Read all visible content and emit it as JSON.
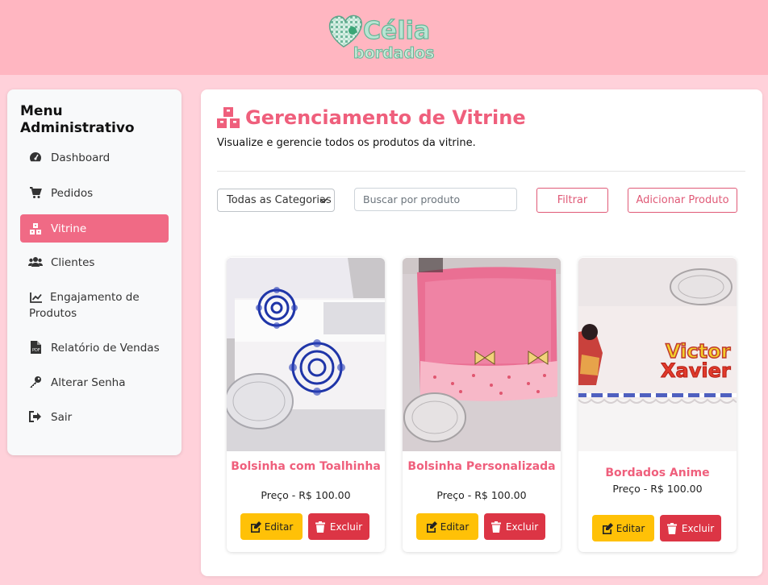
{
  "brand": {
    "logo_line1": "Célia",
    "logo_line2": "bordados"
  },
  "sidebar": {
    "title": "Menu Administrativo",
    "items": [
      {
        "label": "Dashboard",
        "icon": "gauge-icon"
      },
      {
        "label": "Pedidos",
        "icon": "cart-icon"
      },
      {
        "label": "Vitrine",
        "icon": "boxes-icon",
        "active": true
      },
      {
        "label": "Clientes",
        "icon": "users-icon"
      },
      {
        "label": "Engajamento de Produtos",
        "icon": "chart-line-icon"
      },
      {
        "label": "Relatório de Vendas",
        "icon": "pdf-file-icon"
      },
      {
        "label": "Alterar Senha",
        "icon": "key-icon"
      },
      {
        "label": "Sair",
        "icon": "sign-out-icon"
      }
    ]
  },
  "main": {
    "title": "Gerenciamento de Vitrine",
    "subtitle": "Visualize e gerencie todos os produtos da vitrine.",
    "filters": {
      "category_selected": "Todas as Categorias",
      "search_placeholder": "Buscar por produto",
      "filter_label": "Filtrar",
      "add_label": "Adicionar Produto"
    },
    "products": [
      {
        "name": "Bolsinha com Toalhinha",
        "price": "Preço - R$ 100.00",
        "edit": "Editar",
        "delete": "Excluir"
      },
      {
        "name": "Bolsinha Personalizada",
        "price": "Preço - R$ 100.00",
        "edit": "Editar",
        "delete": "Excluir"
      },
      {
        "name": "Bordados Anime",
        "price": "Preço - R$ 100.00",
        "edit": "Editar",
        "delete": "Excluir",
        "embroidery_text": [
          "Victor",
          "Xavier"
        ]
      }
    ]
  },
  "colors": {
    "header": "#ffb6c1",
    "background": "#ffd1da",
    "accent": "#ef5f7c",
    "edit": "#ffc107",
    "delete": "#dc3545"
  }
}
